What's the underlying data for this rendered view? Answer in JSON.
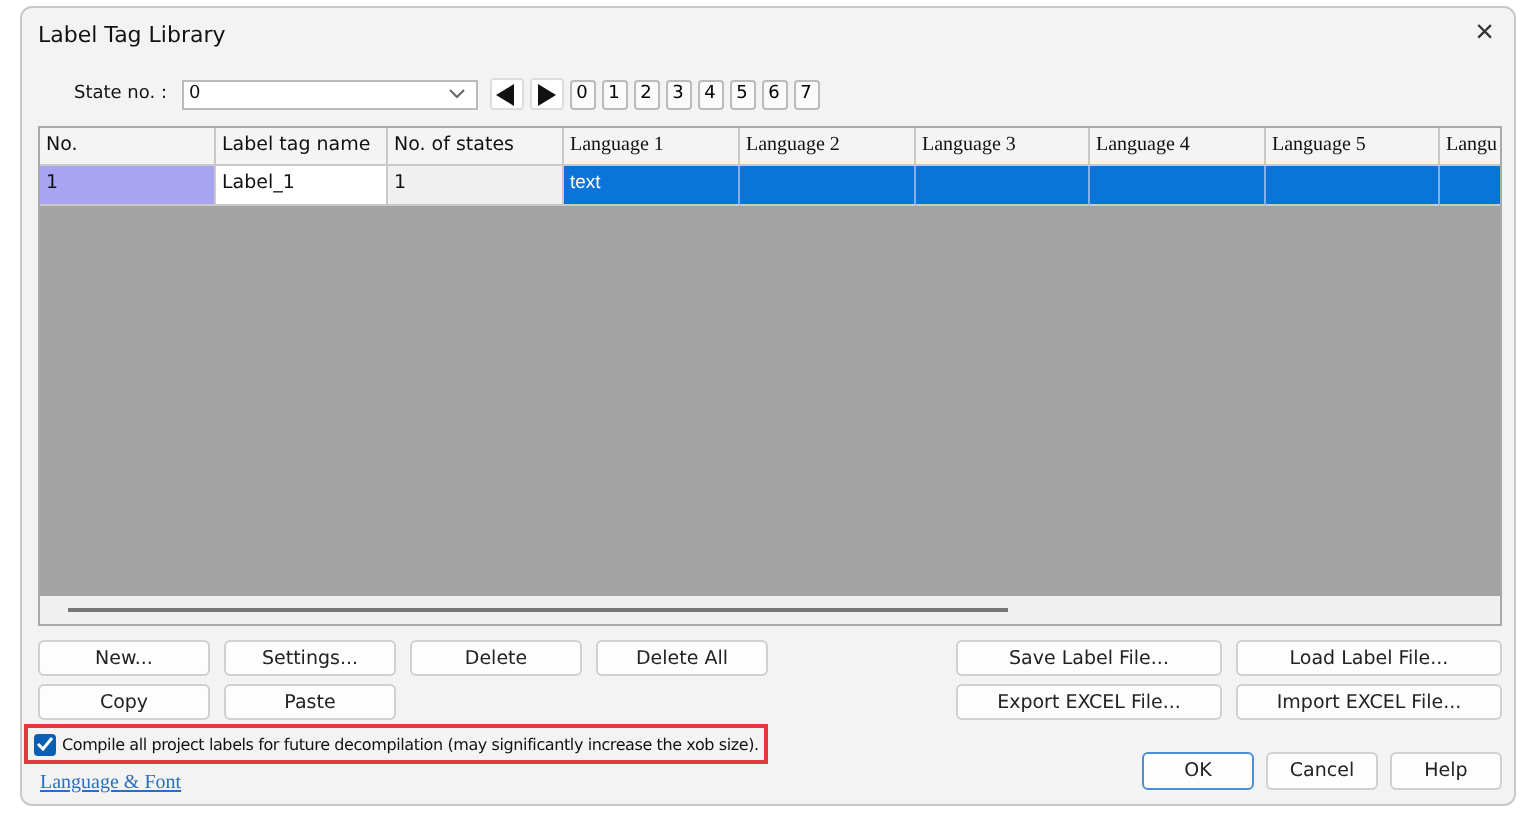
{
  "window": {
    "title": "Label Tag Library",
    "close": "×"
  },
  "state_selector": {
    "label": "State no. :",
    "value": "0",
    "pages": [
      "0",
      "1",
      "2",
      "3",
      "4",
      "5",
      "6",
      "7"
    ]
  },
  "table": {
    "columns": [
      "No.",
      "Label tag name",
      "No. of states",
      "Language 1",
      "Language 2",
      "Language 3",
      "Language 4",
      "Language 5",
      "Langu"
    ],
    "rows": [
      {
        "selected": true,
        "cells": [
          "1",
          "Label_1",
          "1",
          "text",
          "",
          "",
          "",
          "",
          ""
        ]
      }
    ]
  },
  "buttons_left": [
    [
      "New...",
      "Settings...",
      "Delete",
      "Delete All"
    ],
    [
      "Copy",
      "Paste"
    ]
  ],
  "buttons_right": [
    [
      "Save Label File...",
      "Load Label File..."
    ],
    [
      "Export EXCEL File...",
      "Import EXCEL File..."
    ]
  ],
  "compile_option": {
    "label": "Compile all project labels for future decompilation (may significantly increase the xob size).",
    "checked": true
  },
  "link": "Language & Font",
  "dialog_buttons": [
    "OK",
    "Cancel",
    "Help"
  ]
}
